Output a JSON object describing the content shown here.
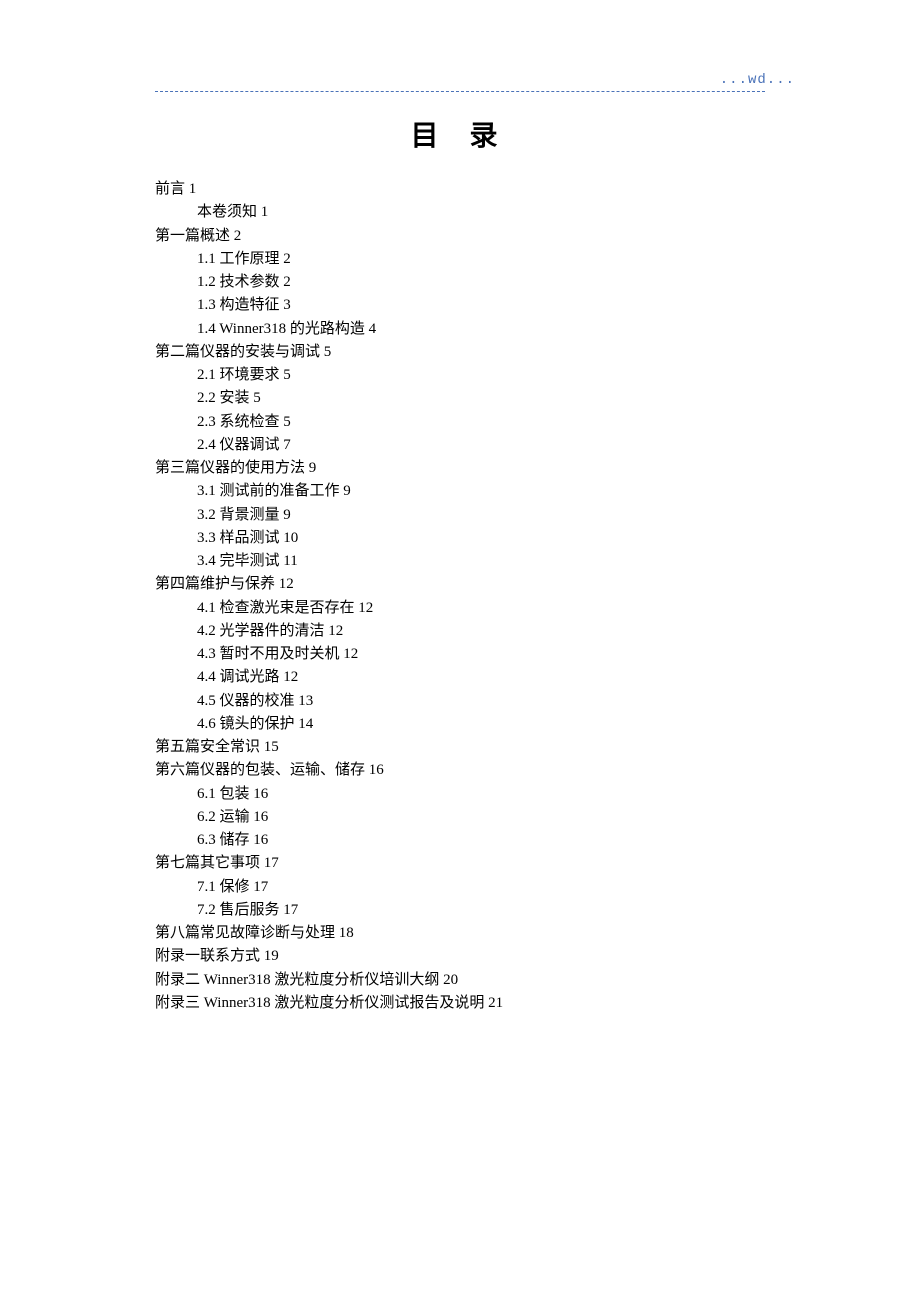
{
  "header": {
    "text": "...wd..."
  },
  "title": "目 录",
  "entries": [
    {
      "level": 0,
      "text": "前言 1"
    },
    {
      "level": 1,
      "text": "本卷须知 1"
    },
    {
      "level": 0,
      "text": "第一篇概述 2"
    },
    {
      "level": 1,
      "text": "1.1 工作原理 2"
    },
    {
      "level": 1,
      "text": "1.2 技术参数 2"
    },
    {
      "level": 1,
      "text": "1.3  构造特征 3"
    },
    {
      "level": 1,
      "text": "1.4 Winner318 的光路构造 4"
    },
    {
      "level": 0,
      "text": "第二篇仪器的安装与调试 5"
    },
    {
      "level": 1,
      "text": "2.1 环境要求 5"
    },
    {
      "level": 1,
      "text": "2.2 安装 5"
    },
    {
      "level": 1,
      "text": "2.3 系统检查 5"
    },
    {
      "level": 1,
      "text": "2.4 仪器调试 7"
    },
    {
      "level": 0,
      "text": "第三篇仪器的使用方法 9"
    },
    {
      "level": 1,
      "text": "3.1 测试前的准备工作 9"
    },
    {
      "level": 1,
      "text": "3.2 背景测量 9"
    },
    {
      "level": 1,
      "text": "3.3 样品测试 10"
    },
    {
      "level": 1,
      "text": "3.4 完毕测试 11"
    },
    {
      "level": 0,
      "text": "第四篇维护与保养 12"
    },
    {
      "level": 1,
      "text": "4.1 检查激光束是否存在 12"
    },
    {
      "level": 1,
      "text": "4.2 光学器件的清洁 12"
    },
    {
      "level": 1,
      "text": "4.3 暂时不用及时关机 12"
    },
    {
      "level": 1,
      "text": "4.4 调试光路 12"
    },
    {
      "level": 1,
      "text": "4.5 仪器的校准 13"
    },
    {
      "level": 1,
      "text": "4.6 镜头的保护 14"
    },
    {
      "level": 0,
      "text": "第五篇安全常识 15"
    },
    {
      "level": 0,
      "text": "第六篇仪器的包装、运输、储存 16"
    },
    {
      "level": 1,
      "text": "6.1 包装 16"
    },
    {
      "level": 1,
      "text": "6.2 运输 16"
    },
    {
      "level": 1,
      "text": "6.3 储存 16"
    },
    {
      "level": 0,
      "text": "第七篇其它事项 17"
    },
    {
      "level": 1,
      "text": "7.1 保修 17"
    },
    {
      "level": 1,
      "text": "7.2 售后服务 17"
    },
    {
      "level": 0,
      "text": "第八篇常见故障诊断与处理 18"
    },
    {
      "level": 0,
      "text": "附录一联系方式 19"
    },
    {
      "level": 0,
      "text": "附录二  Winner318 激光粒度分析仪培训大纲 20"
    },
    {
      "level": 0,
      "text": "附录三 Winner318 激光粒度分析仪测试报告及说明 21"
    }
  ]
}
